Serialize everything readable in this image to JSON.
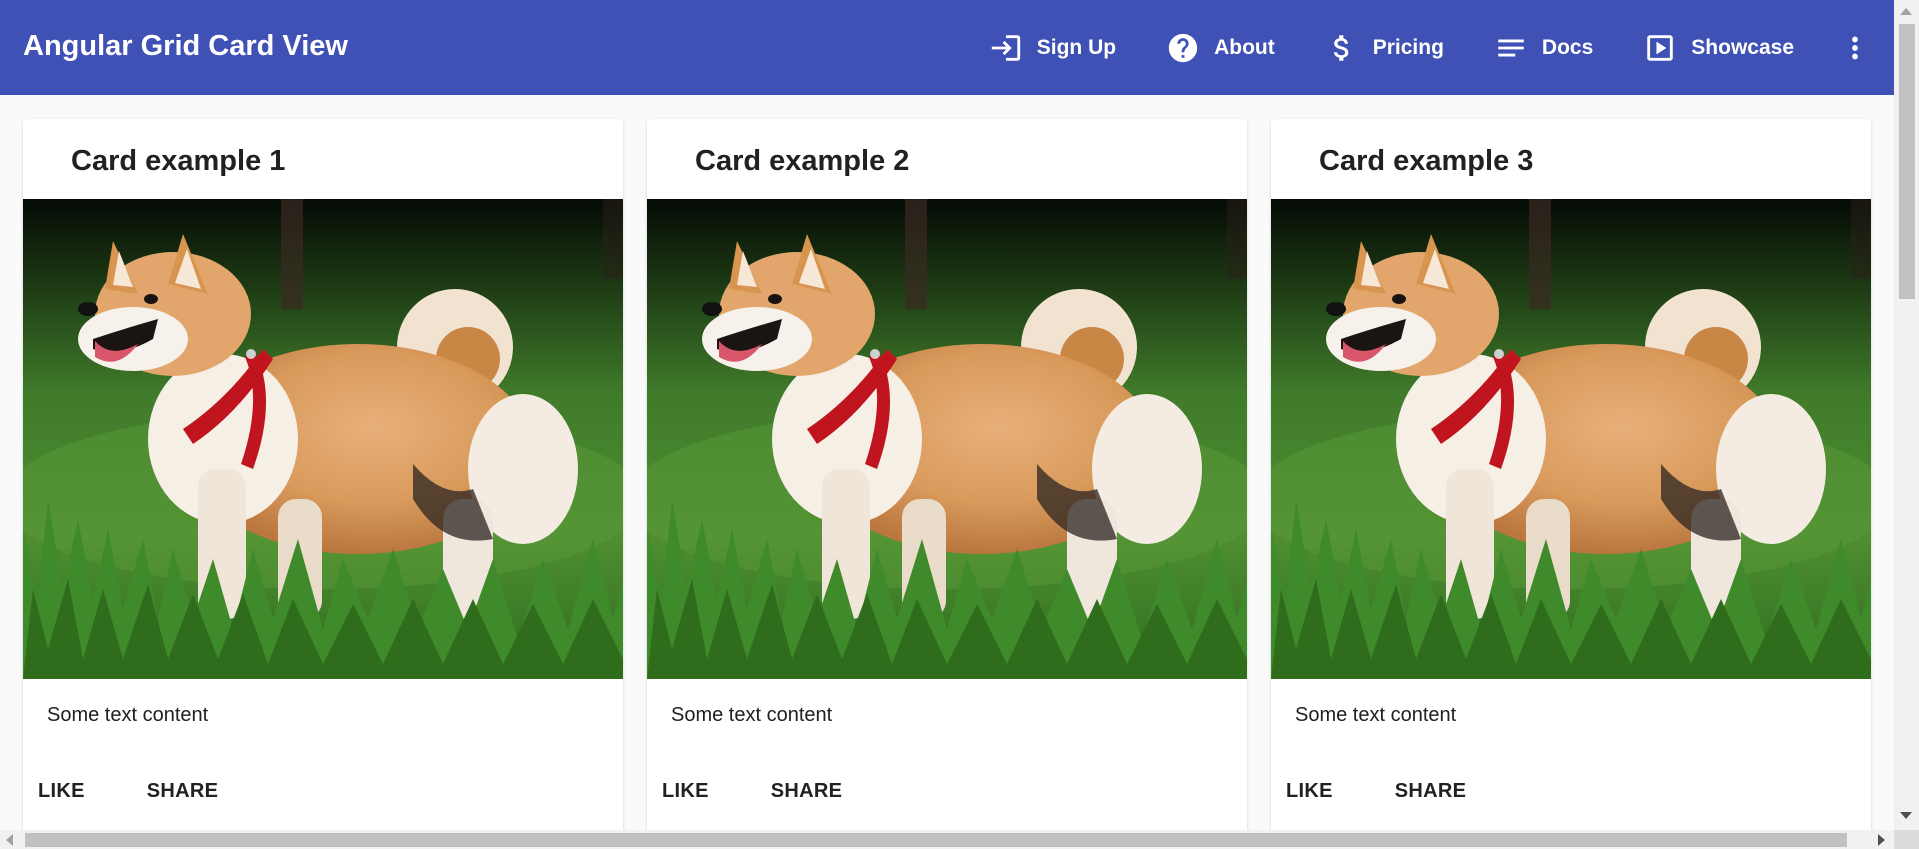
{
  "toolbar": {
    "title": "Angular Grid Card View",
    "nav": [
      {
        "label": "Sign Up",
        "icon": "login-icon"
      },
      {
        "label": "About",
        "icon": "help-icon"
      },
      {
        "label": "Pricing",
        "icon": "dollar-icon"
      },
      {
        "label": "Docs",
        "icon": "notes-icon"
      },
      {
        "label": "Showcase",
        "icon": "play-box-icon"
      }
    ],
    "more_icon": "more-vert-icon",
    "color": "#3f51b5"
  },
  "cards": [
    {
      "title": "Card example 1",
      "image": "shiba-inu-dog-photo",
      "content": "Some text content",
      "actions": [
        "LIKE",
        "SHARE"
      ]
    },
    {
      "title": "Card example 2",
      "image": "shiba-inu-dog-photo",
      "content": "Some text content",
      "actions": [
        "LIKE",
        "SHARE"
      ]
    },
    {
      "title": "Card example 3",
      "image": "shiba-inu-dog-photo",
      "content": "Some text content",
      "actions": [
        "LIKE",
        "SHARE"
      ]
    }
  ]
}
